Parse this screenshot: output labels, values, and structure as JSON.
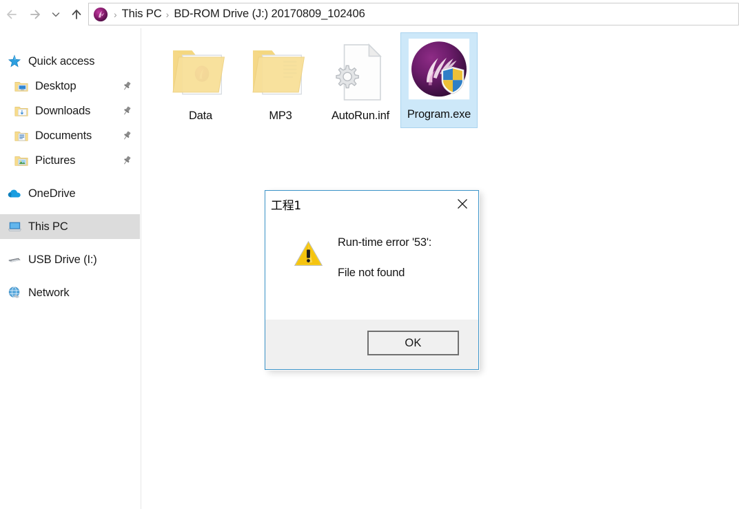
{
  "window": {
    "title": "BD-ROM Drive (J:) 20170809_102406"
  },
  "nav": {
    "back": {
      "label": "Back",
      "icon": "arrow-left-icon",
      "enabled": false
    },
    "forward": {
      "label": "Forward",
      "icon": "arrow-right-icon",
      "enabled": false
    },
    "recent": {
      "label": "Recent locations",
      "icon": "chevron-down-icon"
    },
    "up": {
      "label": "Up",
      "icon": "arrow-up-icon",
      "enabled": true
    }
  },
  "address": {
    "drive_icon": "bd-rom-disc-icon",
    "separator": "›",
    "crumbs": [
      {
        "label": "This PC"
      },
      {
        "label": "BD-ROM Drive (J:) 20170809_102406"
      }
    ]
  },
  "sidebar": {
    "groups": [
      {
        "header": {
          "label": "Quick access",
          "icon": "quick-access-star-icon"
        },
        "items": [
          {
            "label": "Desktop",
            "icon": "desktop-folder-icon",
            "pinned": true
          },
          {
            "label": "Downloads",
            "icon": "downloads-folder-icon",
            "pinned": true
          },
          {
            "label": "Documents",
            "icon": "documents-folder-icon",
            "pinned": true
          },
          {
            "label": "Pictures",
            "icon": "pictures-folder-icon",
            "pinned": true
          }
        ]
      },
      {
        "header": {
          "label": "OneDrive",
          "icon": "onedrive-cloud-icon"
        },
        "items": []
      },
      {
        "header": {
          "label": "This PC",
          "icon": "this-pc-monitor-icon",
          "selected": true
        },
        "items": []
      },
      {
        "header": {
          "label": "USB Drive (I:)",
          "icon": "usb-drive-icon"
        },
        "items": []
      },
      {
        "header": {
          "label": "Network",
          "icon": "network-globe-icon"
        },
        "items": []
      }
    ]
  },
  "files": [
    {
      "name": "Data",
      "icon": "folder-with-disc-icon",
      "type": "folder",
      "selected": false
    },
    {
      "name": "MP3",
      "icon": "folder-with-document-icon",
      "type": "folder",
      "selected": false
    },
    {
      "name": "AutoRun.inf",
      "icon": "inf-gear-file-icon",
      "type": "file",
      "selected": false
    },
    {
      "name": "Program.exe",
      "icon": "program-exe-shield-icon",
      "type": "file",
      "selected": true
    }
  ],
  "dialog": {
    "title": "工程1",
    "close_icon": "close-x-icon",
    "warning_icon": "warning-triangle-icon",
    "messages": [
      "Run-time error '53':",
      "File not found"
    ],
    "ok_label": "OK",
    "border_color": "#3b93c8",
    "footer_color": "#f0f0f0"
  },
  "colors": {
    "selection_fill": "#cde8f9",
    "selection_border": "#a9d3ef",
    "sidebar_selected": "#dcdcdc",
    "folder_yellow": "#f8df8f",
    "dialog_accent": "#3b93c8"
  }
}
